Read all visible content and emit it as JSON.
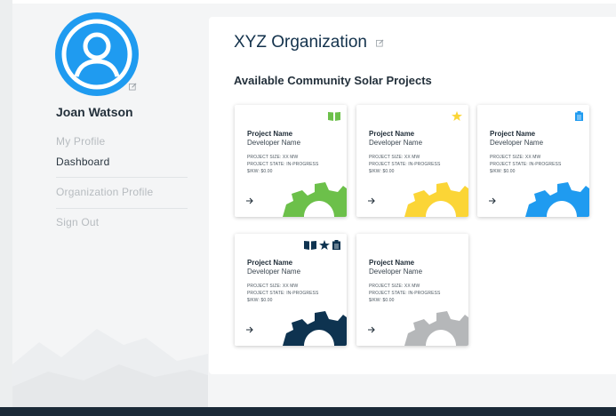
{
  "user": {
    "name": "Joan Watson"
  },
  "nav": {
    "my_profile": "My Profile",
    "dashboard": "Dashboard",
    "organization_profile": "Organization Profile",
    "sign_out": "Sign Out"
  },
  "organization": {
    "name": "XYZ Organization"
  },
  "section": {
    "title": "Available Community Solar Projects"
  },
  "colors": {
    "brand_blue": "#1f9bf0",
    "green": "#6cc04a",
    "yellow": "#fbd536",
    "blue": "#1f9bf0",
    "navy": "#0e3350",
    "gray": "#b5b7b9"
  },
  "projects": [
    {
      "name": "Project Name",
      "developer": "Developer Name",
      "size": "PROJECT SIZE: XX MW",
      "state": "PROJECT STATE: IN-PROGRESS",
      "kw": "$/KW: $0.00",
      "icons": [
        "book-icon"
      ],
      "gear_color": "#6cc04a"
    },
    {
      "name": "Project Name",
      "developer": "Developer Name",
      "size": "PROJECT SIZE: XX MW",
      "state": "PROJECT STATE: IN-PROGRESS",
      "kw": "$/KW: $0.00",
      "icons": [
        "star-icon"
      ],
      "gear_color": "#fbd536"
    },
    {
      "name": "Project Name",
      "developer": "Developer Name",
      "size": "PROJECT SIZE: XX MW",
      "state": "PROJECT STATE: IN-PROGRESS",
      "kw": "$/KW: $0.00",
      "icons": [
        "clipboard-icon"
      ],
      "gear_color": "#1f9bf0"
    },
    {
      "name": "Project Name",
      "developer": "Developer Name",
      "size": "PROJECT SIZE: XX MW",
      "state": "PROJECT STATE: IN-PROGRESS",
      "kw": "$/KW: $0.00",
      "icons": [
        "book-icon",
        "star-icon",
        "clipboard-icon"
      ],
      "gear_color": "#0e3350"
    },
    {
      "name": "Project Name",
      "developer": "Developer Name",
      "size": "PROJECT SIZE: XX MW",
      "state": "PROJECT STATE: IN-PROGRESS",
      "kw": "$/KW: $0.00",
      "icons": [],
      "gear_color": "#b5b7b9"
    }
  ]
}
